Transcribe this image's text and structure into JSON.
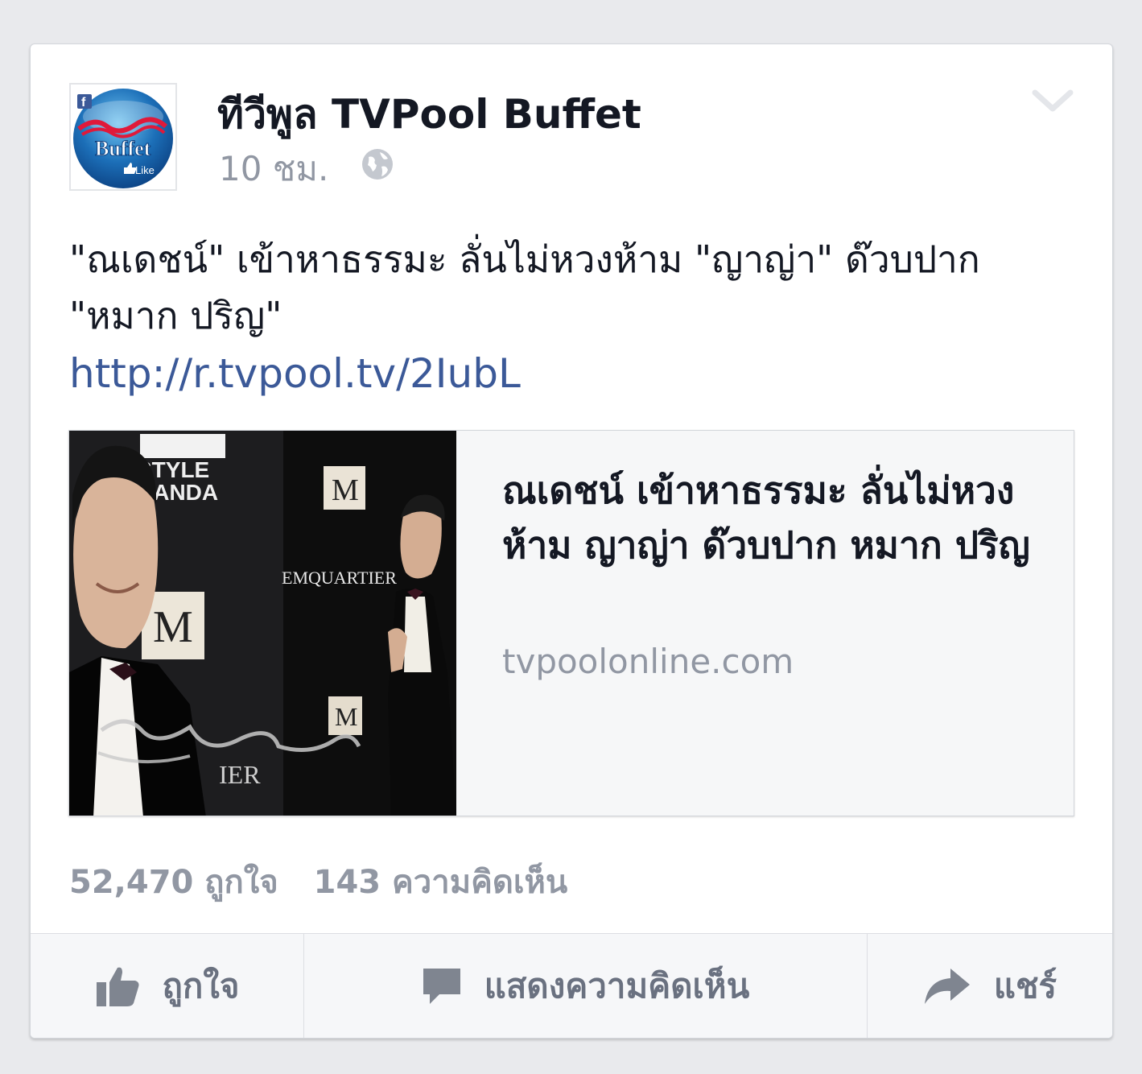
{
  "post": {
    "page_name": "ทีวีพูล TVPool Buffet",
    "time": "10 ชม.",
    "privacy_icon": "globe-icon",
    "menu_icon": "chevron-down-icon",
    "avatar": {
      "logo_text": "Buffet",
      "like_text": "Like"
    },
    "message": "\"ณเดชน์\" เข้าหาธรรมะ ลั่นไม่หวงห้าม \"ญาญ่า\" ด๊วบปาก \"หมาก ปริญ\"",
    "link": "http://r.tvpool.tv/2IubL"
  },
  "preview": {
    "title": "ณเดชน์ เข้าหาธรรมะ ลั่นไม่หวงห้าม ญาญ่า ด๊วบปาก หมาก ปริญ",
    "domain": "tvpoolonline.com",
    "image_texts": {
      "style": "STYLE",
      "nanda": "NANDA",
      "quartier": "EMQUARTIER",
      "m": "M",
      "ier": "IER"
    }
  },
  "counts": {
    "likes": "52,470 ถูกใจ",
    "comments": "143 ความคิดเห็น"
  },
  "actions": {
    "like": "ถูกใจ",
    "comment": "แสดงความคิดเห็น",
    "share": "แชร์"
  },
  "colors": {
    "link": "#3b5998",
    "muted": "#9197a3",
    "text": "#141823",
    "background": "#e9eaed"
  }
}
